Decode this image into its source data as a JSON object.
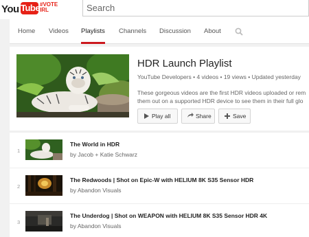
{
  "masthead": {
    "logo_you": "You",
    "logo_tube": "Tube",
    "logo_tag_line1": "#VOTE",
    "logo_tag_line2": "IRL",
    "search_placeholder": "Search"
  },
  "channel_nav": {
    "tabs": [
      {
        "label": "Home",
        "active": false
      },
      {
        "label": "Videos",
        "active": false
      },
      {
        "label": "Playlists",
        "active": true
      },
      {
        "label": "Channels",
        "active": false
      },
      {
        "label": "Discussion",
        "active": false
      },
      {
        "label": "About",
        "active": false
      }
    ],
    "search_icon": "magnifier-icon"
  },
  "playlist": {
    "title": "HDR Launch Playlist",
    "meta": "YouTube Developers • 4 videos • 19 views • Updated yesterday",
    "description_line1": "These gorgeous videos are the first HDR videos uploaded or rem",
    "description_line2": "them out on a supported HDR device to see them in their full glo",
    "buttons": {
      "play_all": "Play all",
      "share": "Share",
      "save": "Save"
    }
  },
  "videos": [
    {
      "index": "1",
      "title": "The World in HDR",
      "owner": "by Jacob + Katie Schwarz"
    },
    {
      "index": "2",
      "title": "The Redwoods | Shot on Epic-W with HELIUM 8K S35 Sensor HDR",
      "owner": "by Abandon Visuals"
    },
    {
      "index": "3",
      "title": "The Underdog | Shot on WEAPON with HELIUM 8K S35 Sensor HDR 4K",
      "owner": "by Abandon Visuals"
    }
  ],
  "colors": {
    "brand_red": "#e62117",
    "active_tab_underline": "#cc181e",
    "page_bg": "#f1f1f1"
  }
}
